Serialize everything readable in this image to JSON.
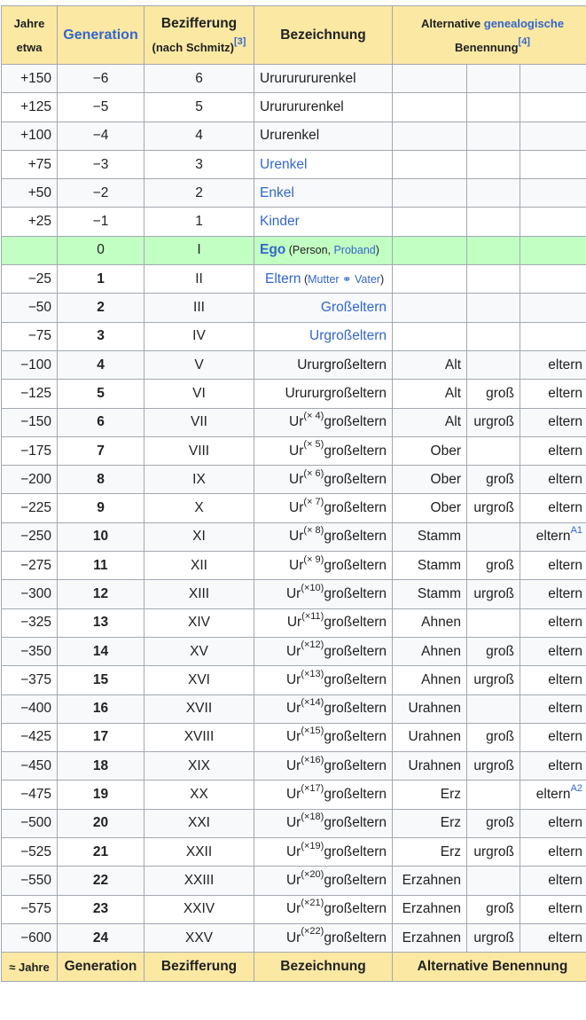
{
  "header": {
    "col0_line1": "Jahre",
    "col0_line2": "etwa",
    "col1": "Generation",
    "col2_line1": "Bezifferung",
    "col2_line2": "(nach Schmitz)",
    "col2_ref": "[3]",
    "col3": "Bezeichnung",
    "col4_line1_a": "Alternative ",
    "col4_line1_link": "genealogische",
    "col4_line2": "Benennung",
    "col4_ref": "[4]"
  },
  "footer": {
    "col0": "≈ Jahre",
    "col1": "Generation",
    "col2": "Bezifferung",
    "col3": "Bezeichnung",
    "col4": "Alternative Benennung"
  },
  "rows": [
    {
      "jahre": "+150",
      "gen": "−6",
      "bez": "6",
      "name": "Urururururenkel"
    },
    {
      "jahre": "+125",
      "gen": "−5",
      "bez": "5",
      "name": "Ururururenkel"
    },
    {
      "jahre": "+100",
      "gen": "−4",
      "bez": "4",
      "name": "Ururenkel"
    },
    {
      "jahre": "+75",
      "gen": "−3",
      "bez": "3",
      "name": "Urenkel"
    },
    {
      "jahre": "+50",
      "gen": "−2",
      "bez": "2",
      "name": "Enkel"
    },
    {
      "jahre": "+25",
      "gen": "−1",
      "bez": "1",
      "name": "Kinder"
    },
    {
      "jahre": "",
      "gen": "0",
      "bez": "I",
      "name": "Ego",
      "open": " (Person, ",
      "link": "Proband",
      "close": ")"
    },
    {
      "jahre": "−25",
      "gen": "1",
      "bez": "II",
      "name": "Eltern",
      "open": " (",
      "link": "Mutter ⚭ Vater",
      "close": ")"
    },
    {
      "jahre": "−50",
      "gen": "2",
      "bez": "III",
      "name": "Großeltern"
    },
    {
      "jahre": "−75",
      "gen": "3",
      "bez": "IV",
      "name": "Urgroßeltern"
    },
    {
      "jahre": "−100",
      "gen": "4",
      "bez": "V",
      "name": "Ururgroßeltern",
      "a": "Alt",
      "b": "",
      "c": "eltern"
    },
    {
      "jahre": "−125",
      "gen": "5",
      "bez": "VI",
      "name": "Urururgroßeltern",
      "a": "Alt",
      "b": "groß",
      "c": "eltern"
    },
    {
      "jahre": "−150",
      "gen": "6",
      "bez": "VII",
      "pre": "Ur",
      "sup": "(× 4)",
      "post": "großeltern",
      "a": "Alt",
      "b": "urgroß",
      "c": "eltern"
    },
    {
      "jahre": "−175",
      "gen": "7",
      "bez": "VIII",
      "pre": "Ur",
      "sup": "(× 5)",
      "post": "großeltern",
      "a": "Ober",
      "b": "",
      "c": "eltern"
    },
    {
      "jahre": "−200",
      "gen": "8",
      "bez": "IX",
      "pre": "Ur",
      "sup": "(× 6)",
      "post": "großeltern",
      "a": "Ober",
      "b": "groß",
      "c": "eltern"
    },
    {
      "jahre": "−225",
      "gen": "9",
      "bez": "X",
      "pre": "Ur",
      "sup": "(× 7)",
      "post": "großeltern",
      "a": "Ober",
      "b": "urgroß",
      "c": "eltern"
    },
    {
      "jahre": "−250",
      "gen": "10",
      "bez": "XI",
      "pre": "Ur",
      "sup": "(× 8)",
      "post": "großeltern",
      "a": "Stamm",
      "b": "",
      "c": "eltern",
      "cref": "A1"
    },
    {
      "jahre": "−275",
      "gen": "11",
      "bez": "XII",
      "pre": "Ur",
      "sup": "(× 9)",
      "post": "großeltern",
      "a": "Stamm",
      "b": "groß",
      "c": "eltern"
    },
    {
      "jahre": "−300",
      "gen": "12",
      "bez": "XIII",
      "pre": "Ur",
      "sup": "(×10)",
      "post": "großeltern",
      "a": "Stamm",
      "b": "urgroß",
      "c": "eltern"
    },
    {
      "jahre": "−325",
      "gen": "13",
      "bez": "XIV",
      "pre": "Ur",
      "sup": "(×11)",
      "post": "großeltern",
      "a": "Ahnen",
      "b": "",
      "c": "eltern"
    },
    {
      "jahre": "−350",
      "gen": "14",
      "bez": "XV",
      "pre": "Ur",
      "sup": "(×12)",
      "post": "großeltern",
      "a": "Ahnen",
      "b": "groß",
      "c": "eltern"
    },
    {
      "jahre": "−375",
      "gen": "15",
      "bez": "XVI",
      "pre": "Ur",
      "sup": "(×13)",
      "post": "großeltern",
      "a": "Ahnen",
      "b": "urgroß",
      "c": "eltern"
    },
    {
      "jahre": "−400",
      "gen": "16",
      "bez": "XVII",
      "pre": "Ur",
      "sup": "(×14)",
      "post": "großeltern",
      "a": "Urahnen",
      "b": "",
      "c": "eltern"
    },
    {
      "jahre": "−425",
      "gen": "17",
      "bez": "XVIII",
      "pre": "Ur",
      "sup": "(×15)",
      "post": "großeltern",
      "a": "Urahnen",
      "b": "groß",
      "c": "eltern"
    },
    {
      "jahre": "−450",
      "gen": "18",
      "bez": "XIX",
      "pre": "Ur",
      "sup": "(×16)",
      "post": "großeltern",
      "a": "Urahnen",
      "b": "urgroß",
      "c": "eltern"
    },
    {
      "jahre": "−475",
      "gen": "19",
      "bez": "XX",
      "pre": "Ur",
      "sup": "(×17)",
      "post": "großeltern",
      "a": "Erz",
      "b": "",
      "c": "eltern",
      "cref": "A2"
    },
    {
      "jahre": "−500",
      "gen": "20",
      "bez": "XXI",
      "pre": "Ur",
      "sup": "(×18)",
      "post": "großeltern",
      "a": "Erz",
      "b": "groß",
      "c": "eltern"
    },
    {
      "jahre": "−525",
      "gen": "21",
      "bez": "XXII",
      "pre": "Ur",
      "sup": "(×19)",
      "post": "großeltern",
      "a": "Erz",
      "b": "urgroß",
      "c": "eltern"
    },
    {
      "jahre": "−550",
      "gen": "22",
      "bez": "XXIII",
      "pre": "Ur",
      "sup": "(×20)",
      "post": "großeltern",
      "a": "Erzahnen",
      "b": "",
      "c": "eltern"
    },
    {
      "jahre": "−575",
      "gen": "23",
      "bez": "XXIV",
      "pre": "Ur",
      "sup": "(×21)",
      "post": "großeltern",
      "a": "Erzahnen",
      "b": "groß",
      "c": "eltern"
    },
    {
      "jahre": "−600",
      "gen": "24",
      "bez": "XXV",
      "pre": "Ur",
      "sup": "(×22)",
      "post": "großeltern",
      "a": "Erzahnen",
      "b": "urgroß",
      "c": "eltern"
    }
  ],
  "colors": {
    "header_bg": "#fbe8a3",
    "ego_bg": "#c2ffc2",
    "link": "#3366cc",
    "border": "#a2a9b1"
  }
}
